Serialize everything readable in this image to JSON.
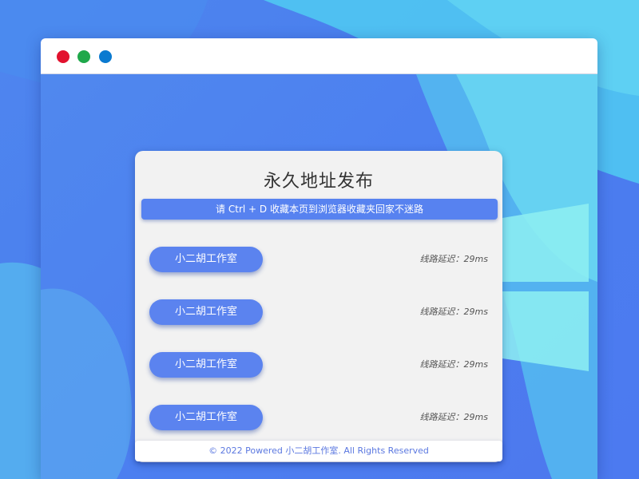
{
  "window": {
    "controls": [
      {
        "name": "close",
        "color": "#e2122e"
      },
      {
        "name": "minimize",
        "color": "#1fa84a"
      },
      {
        "name": "maximize",
        "color": "#0a7ad0"
      }
    ]
  },
  "card": {
    "title": "永久地址发布",
    "notice": "请 Ctrl + D 收藏本页到浏览器收藏夹回家不迷路",
    "links": [
      {
        "label": "小二胡工作室",
        "latency": "线路延迟：29ms"
      },
      {
        "label": "小二胡工作室",
        "latency": "线路延迟：29ms"
      },
      {
        "label": "小二胡工作室",
        "latency": "线路延迟：29ms"
      },
      {
        "label": "小二胡工作室",
        "latency": "线路延迟：29ms"
      }
    ]
  },
  "footer": {
    "text": "© 2022 Powered 小二胡工作室. All Rights Reserved"
  },
  "colors": {
    "accent": "#5b83ef",
    "background": "#4c7ff0",
    "card": "#f2f2f2"
  }
}
